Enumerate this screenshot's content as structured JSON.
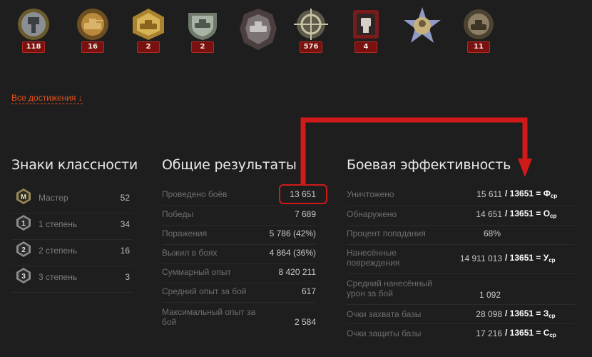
{
  "medals": [
    {
      "icon": "aces-tanker-medal-icon",
      "count": "118"
    },
    {
      "icon": "tank-medal-icon",
      "count": "16"
    },
    {
      "icon": "gold-tank-medal-icon",
      "count": "2"
    },
    {
      "icon": "silver-tank-medal-icon",
      "count": "2"
    },
    {
      "icon": "dark-tank-medal-icon",
      "count": null
    },
    {
      "icon": "sniper-medal-icon",
      "count": "576"
    },
    {
      "icon": "fist-medal-icon",
      "count": "4"
    },
    {
      "icon": "star-portrait-medal-icon",
      "count": null
    },
    {
      "icon": "tank-shield-medal-icon",
      "count": "11"
    }
  ],
  "all_achievements": "Все достижения ↓",
  "class_marks": {
    "title": "Знаки классности",
    "rows": [
      {
        "icon": "master-mark-icon",
        "mark": "M",
        "label": "Мастер",
        "value": "52"
      },
      {
        "icon": "first-class-mark-icon",
        "mark": "1",
        "label": "1 степень",
        "value": "34"
      },
      {
        "icon": "second-class-mark-icon",
        "mark": "2",
        "label": "2 степень",
        "value": "16"
      },
      {
        "icon": "third-class-mark-icon",
        "mark": "3",
        "label": "3 степень",
        "value": "3"
      }
    ]
  },
  "overall": {
    "title": "Общие результаты",
    "rows": [
      {
        "label": "Проведено боёв",
        "value": "13 651"
      },
      {
        "label": "Победы",
        "value": "7 689"
      },
      {
        "label": "Поражения",
        "value": "5 786 (42%)"
      },
      {
        "label": "Выжил в боях",
        "value": "4 864 (36%)"
      },
      {
        "label": "Суммарный опыт",
        "value": "8 420 211"
      },
      {
        "label": "Средний опыт за бой",
        "value": "617"
      },
      {
        "label": "Максимальный опыт за бой",
        "value": "2 584"
      }
    ]
  },
  "efficiency": {
    "title": "Боевая эффективность",
    "rows": [
      {
        "label": "Уничтожено",
        "value": "15 611",
        "formula": "/ 13651 = Ф",
        "sub": "ср"
      },
      {
        "label": "Обнаружено",
        "value": "14 651",
        "formula": "/ 13651 = О",
        "sub": "ср"
      },
      {
        "label": "Процент попадания",
        "value": "68%",
        "formula": "",
        "sub": ""
      },
      {
        "label": "Нанесённые повреждения",
        "value": "14 911 013",
        "formula": "/ 13651 = У",
        "sub": "ср"
      },
      {
        "label": "Средний нанесённый урон за бой",
        "value": "1 092",
        "formula": "",
        "sub": ""
      },
      {
        "label": "Очки захвата базы",
        "value": "28 098",
        "formula": "/ 13651 = З",
        "sub": "ср"
      },
      {
        "label": "Очки защиты базы",
        "value": "17 216",
        "formula": "/ 13651 = С",
        "sub": "ср"
      }
    ]
  },
  "colors": {
    "background": "#1e1e1e",
    "link": "#e0531f",
    "highlight": "#d01a1a",
    "badge": "#7a1111"
  }
}
